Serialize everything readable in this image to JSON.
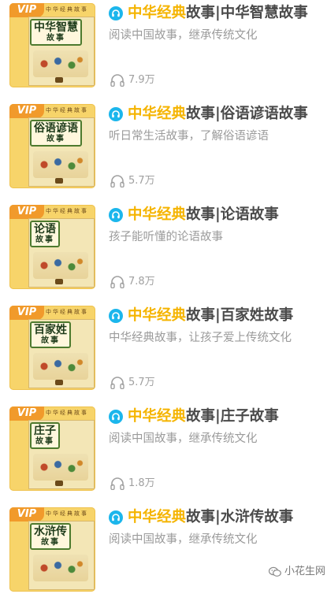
{
  "colors": {
    "brand": "#f5b400",
    "title": "#4a4a4a",
    "description": "#9b9b9b",
    "count": "#a0a0a0",
    "play_icon": "#1bb6ec",
    "vip_badge": "#f19a2b"
  },
  "icons": {
    "play": "play-circle-icon",
    "headphones": "headphones-icon",
    "watermark": "wechat-icon"
  },
  "items": [
    {
      "brand": "中华经典",
      "title_rest": "故事|中华智慧故事",
      "description": "阅读中国故事，继承传统文化",
      "plays": "7.9万",
      "cover": {
        "vip": "VIP",
        "title": "中华智慧",
        "subtitle": "故事",
        "series": "中华经典故事"
      }
    },
    {
      "brand": "中华经典",
      "title_rest": "故事|俗语谚语故事",
      "description": "听日常生活故事，了解俗语谚语",
      "plays": "5.7万",
      "cover": {
        "vip": "VIP",
        "title": "俗语谚语",
        "subtitle": "故事",
        "series": "中华经典故事"
      }
    },
    {
      "brand": "中华经典",
      "title_rest": "故事|论语故事",
      "description": "孩子能听懂的论语故事",
      "plays": "7.8万",
      "cover": {
        "vip": "VIP",
        "title": "论语",
        "subtitle": "故事",
        "series": "中华经典故事"
      }
    },
    {
      "brand": "中华经典",
      "title_rest": "故事|百家姓故事",
      "description": "中华经典故事，让孩子爱上传统文化",
      "plays": "5.7万",
      "cover": {
        "vip": "VIP",
        "title": "百家姓",
        "subtitle": "故事",
        "series": "中华经典故事"
      }
    },
    {
      "brand": "中华经典",
      "title_rest": "故事|庄子故事",
      "description": "阅读中国故事，继承传统文化",
      "plays": "1.8万",
      "cover": {
        "vip": "VIP",
        "title": "庄子",
        "subtitle": "故事",
        "series": "中华经典故事"
      }
    },
    {
      "brand": "中华经典",
      "title_rest": "故事|水浒传故事",
      "description": "阅读中国故事，继承传统文化",
      "plays": "",
      "cover": {
        "vip": "VIP",
        "title": "水浒传",
        "subtitle": "故事",
        "series": "中华经典故事"
      }
    }
  ],
  "watermark": {
    "text": "小花生网"
  }
}
